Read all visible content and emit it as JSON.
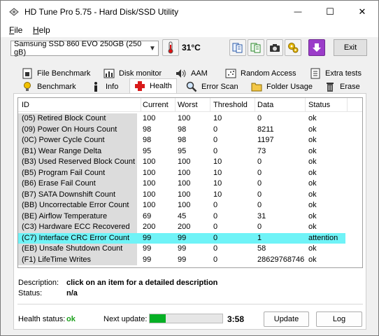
{
  "window": {
    "title": "HD Tune Pro 5.75 - Hard Disk/SSD Utility",
    "minimize_glyph": "—",
    "maximize_glyph": "☐",
    "close_glyph": "✕"
  },
  "menu": {
    "file": {
      "accel": "F",
      "rest": "ile"
    },
    "help": {
      "accel": "H",
      "rest": "elp"
    }
  },
  "toolbar": {
    "drive": "Samsung SSD 860 EVO 250GB (250 gB)",
    "temperature": "31°C",
    "exit_label": "Exit"
  },
  "tabs": {
    "row1": [
      {
        "label": "File Benchmark",
        "icon": "file-benchmark-icon"
      },
      {
        "label": "Disk monitor",
        "icon": "disk-monitor-icon"
      },
      {
        "label": "AAM",
        "icon": "speaker-icon"
      },
      {
        "label": "Random Access",
        "icon": "random-access-icon"
      },
      {
        "label": "Extra tests",
        "icon": "extra-tests-icon"
      }
    ],
    "row2": [
      {
        "label": "Benchmark",
        "icon": "benchmark-icon"
      },
      {
        "label": "Info",
        "icon": "info-icon"
      },
      {
        "label": "Health",
        "icon": "health-cross-icon"
      },
      {
        "label": "Error Scan",
        "icon": "magnifier-icon"
      },
      {
        "label": "Folder Usage",
        "icon": "folder-icon"
      },
      {
        "label": "Erase",
        "icon": "trash-icon"
      }
    ]
  },
  "health_table": {
    "headers": [
      "ID",
      "Current",
      "Worst",
      "Threshold",
      "Data",
      "Status"
    ],
    "rows": [
      [
        "(05) Retired Block Count",
        "100",
        "100",
        "10",
        "0",
        "ok"
      ],
      [
        "(09) Power On Hours Count",
        "98",
        "98",
        "0",
        "8211",
        "ok"
      ],
      [
        "(0C) Power Cycle Count",
        "98",
        "98",
        "0",
        "1197",
        "ok"
      ],
      [
        "(B1) Wear Range Delta",
        "95",
        "95",
        "0",
        "73",
        "ok"
      ],
      [
        "(B3) Used Reserved Block Count",
        "100",
        "100",
        "10",
        "0",
        "ok"
      ],
      [
        "(B5) Program Fail Count",
        "100",
        "100",
        "10",
        "0",
        "ok"
      ],
      [
        "(B6) Erase Fail Count",
        "100",
        "100",
        "10",
        "0",
        "ok"
      ],
      [
        "(B7) SATA Downshift Count",
        "100",
        "100",
        "10",
        "0",
        "ok"
      ],
      [
        "(BB) Uncorrectable Error Count",
        "100",
        "100",
        "0",
        "0",
        "ok"
      ],
      [
        "(BE) Airflow Temperature",
        "69",
        "45",
        "0",
        "31",
        "ok"
      ],
      [
        "(C3) Hardware ECC Recovered",
        "200",
        "200",
        "0",
        "0",
        "ok"
      ],
      [
        "(C7) Interface CRC Error Count",
        "99",
        "99",
        "0",
        "1",
        "attention"
      ],
      [
        "(EB) Unsafe Shutdown Count",
        "99",
        "99",
        "0",
        "58",
        "ok"
      ],
      [
        "(F1) LifeTime Writes",
        "99",
        "99",
        "0",
        "28629768746",
        "ok"
      ]
    ],
    "highlight_row": 11,
    "highlight_color": "#6ff3f7"
  },
  "details": {
    "description_label": "Description:",
    "description_value": "click on an item for a detailed description",
    "status_label": "Status:",
    "status_value": "n/a"
  },
  "footer": {
    "health_status_label": "Health status:",
    "health_status_value": "ok",
    "health_status_color": "#1aa01a",
    "next_update_label": "Next update:",
    "progress_fraction": 0.22,
    "progress_color": "#06b025",
    "countdown": "3:58",
    "update_label": "Update",
    "log_label": "Log"
  }
}
